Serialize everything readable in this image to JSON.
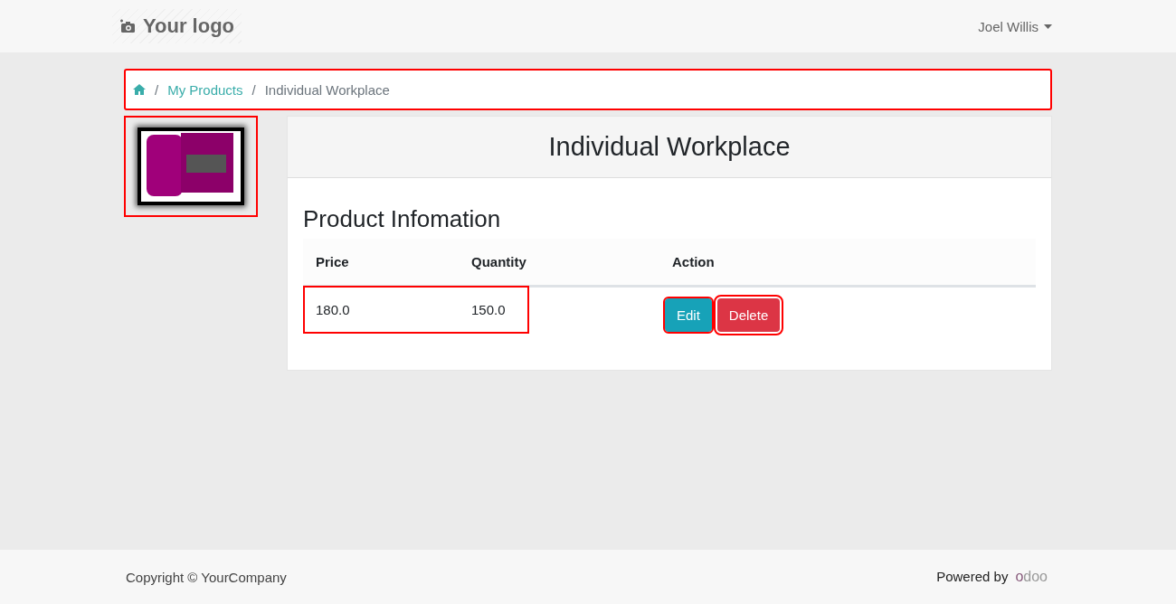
{
  "header": {
    "logo": "Your logo",
    "user": "Joel Willis"
  },
  "breadcrumb": {
    "highlighted": true,
    "items": [
      {
        "separator": "/",
        "label": "My Products",
        "kind": "link"
      },
      {
        "separator": "/",
        "label": "Individual Workplace",
        "kind": "current"
      }
    ]
  },
  "product_image": {
    "highlighted": true
  },
  "title": "Individual Workplace",
  "section_title": "Product Infomation",
  "table": {
    "columns": [
      "Price",
      "Quantity",
      "Action"
    ],
    "rows": [
      {
        "highlighted": true,
        "price": "180.0",
        "quantity": "150.0",
        "actions": [
          {
            "label": "Edit",
            "kind": "primary",
            "highlighted": true
          },
          {
            "label": "Delete",
            "kind": "danger",
            "highlighted": true
          }
        ]
      }
    ]
  },
  "footer": {
    "copyright": "Copyright © YourCompany",
    "powered_by": "Powered by",
    "brand": "odoo"
  }
}
